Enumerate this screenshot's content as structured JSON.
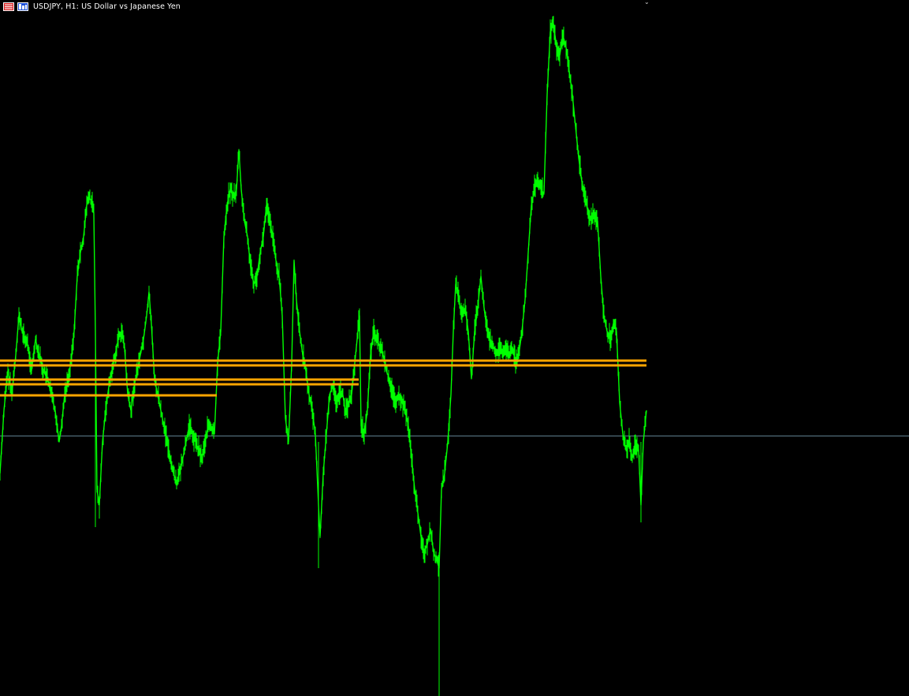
{
  "chart": {
    "title": "USDJPY, H1:  US Dollar vs Japanese Yen",
    "icons": {
      "menu": "menu-list-icon",
      "chart_type": "chart-type-icon"
    }
  },
  "colors": {
    "background": "#000000",
    "price_line": "#00ff00",
    "levels": "#ffa500",
    "current_price_line": "#5f7f8f",
    "title_text": "#ffffff"
  },
  "chart_data": {
    "type": "line",
    "title": "USDJPY, H1:  US Dollar vs Japanese Yen",
    "xlabel": "",
    "ylabel": "",
    "grid": false,
    "xlim": [
      0,
      820
    ],
    "ylim": [
      0,
      882
    ],
    "series": [
      {
        "points": [
          [
            0,
            600
          ],
          [
            5,
            520
          ],
          [
            10,
            470
          ],
          [
            15,
            500
          ],
          [
            20,
            450
          ],
          [
            24,
            400
          ],
          [
            28,
            420
          ],
          [
            32,
            430
          ],
          [
            36,
            440
          ],
          [
            40,
            470
          ],
          [
            45,
            430
          ],
          [
            50,
            450
          ],
          [
            55,
            470
          ],
          [
            60,
            480
          ],
          [
            65,
            500
          ],
          [
            70,
            520
          ],
          [
            75,
            560
          ],
          [
            78,
            540
          ],
          [
            82,
            500
          ],
          [
            86,
            480
          ],
          [
            90,
            460
          ],
          [
            94,
            420
          ],
          [
            98,
            350
          ],
          [
            102,
            320
          ],
          [
            106,
            300
          ],
          [
            110,
            260
          ],
          [
            113,
            250
          ],
          [
            116,
            255
          ],
          [
            119,
            270
          ],
          [
            121,
            420
          ],
          [
            123,
            620
          ],
          [
            126,
            640
          ],
          [
            130,
            560
          ],
          [
            134,
            520
          ],
          [
            138,
            490
          ],
          [
            142,
            470
          ],
          [
            146,
            450
          ],
          [
            150,
            430
          ],
          [
            154,
            420
          ],
          [
            158,
            440
          ],
          [
            162,
            500
          ],
          [
            166,
            520
          ],
          [
            170,
            490
          ],
          [
            174,
            470
          ],
          [
            178,
            450
          ],
          [
            182,
            430
          ],
          [
            186,
            400
          ],
          [
            189,
            370
          ],
          [
            192,
            410
          ],
          [
            196,
            480
          ],
          [
            200,
            500
          ],
          [
            204,
            520
          ],
          [
            208,
            540
          ],
          [
            212,
            560
          ],
          [
            216,
            580
          ],
          [
            220,
            600
          ],
          [
            224,
            610
          ],
          [
            228,
            600
          ],
          [
            232,
            580
          ],
          [
            236,
            560
          ],
          [
            240,
            540
          ],
          [
            244,
            550
          ],
          [
            248,
            560
          ],
          [
            252,
            570
          ],
          [
            256,
            580
          ],
          [
            260,
            560
          ],
          [
            264,
            540
          ],
          [
            268,
            545
          ],
          [
            272,
            550
          ],
          [
            276,
            460
          ],
          [
            280,
            420
          ],
          [
            284,
            300
          ],
          [
            288,
            260
          ],
          [
            292,
            240
          ],
          [
            296,
            250
          ],
          [
            300,
            240
          ],
          [
            303,
            190
          ],
          [
            306,
            240
          ],
          [
            310,
            280
          ],
          [
            314,
            300
          ],
          [
            318,
            340
          ],
          [
            322,
            360
          ],
          [
            326,
            350
          ],
          [
            330,
            320
          ],
          [
            334,
            300
          ],
          [
            338,
            260
          ],
          [
            342,
            280
          ],
          [
            346,
            300
          ],
          [
            350,
            330
          ],
          [
            354,
            350
          ],
          [
            358,
            400
          ],
          [
            362,
            530
          ],
          [
            366,
            560
          ],
          [
            370,
            460
          ],
          [
            373,
            330
          ],
          [
            376,
            380
          ],
          [
            380,
            420
          ],
          [
            384,
            450
          ],
          [
            388,
            470
          ],
          [
            392,
            500
          ],
          [
            396,
            520
          ],
          [
            400,
            550
          ],
          [
            404,
            640
          ],
          [
            406,
            680
          ],
          [
            410,
            600
          ],
          [
            414,
            550
          ],
          [
            418,
            500
          ],
          [
            422,
            490
          ],
          [
            426,
            510
          ],
          [
            430,
            500
          ],
          [
            434,
            495
          ],
          [
            438,
            520
          ],
          [
            442,
            510
          ],
          [
            446,
            500
          ],
          [
            450,
            460
          ],
          [
            454,
            420
          ],
          [
            456,
            400
          ],
          [
            458,
            540
          ],
          [
            462,
            550
          ],
          [
            466,
            520
          ],
          [
            470,
            450
          ],
          [
            474,
            420
          ],
          [
            478,
            430
          ],
          [
            482,
            440
          ],
          [
            486,
            450
          ],
          [
            490,
            470
          ],
          [
            494,
            480
          ],
          [
            498,
            500
          ],
          [
            502,
            510
          ],
          [
            506,
            505
          ],
          [
            510,
            510
          ],
          [
            514,
            520
          ],
          [
            518,
            540
          ],
          [
            522,
            580
          ],
          [
            526,
            620
          ],
          [
            530,
            650
          ],
          [
            534,
            680
          ],
          [
            538,
            700
          ],
          [
            542,
            690
          ],
          [
            546,
            670
          ],
          [
            550,
            700
          ],
          [
            554,
            710
          ],
          [
            557,
            720
          ],
          [
            560,
            620
          ],
          [
            564,
            600
          ],
          [
            568,
            560
          ],
          [
            572,
            500
          ],
          [
            575,
            420
          ],
          [
            578,
            360
          ],
          [
            582,
            380
          ],
          [
            586,
            400
          ],
          [
            590,
            390
          ],
          [
            594,
            420
          ],
          [
            598,
            480
          ],
          [
            602,
            420
          ],
          [
            606,
            390
          ],
          [
            610,
            350
          ],
          [
            614,
            390
          ],
          [
            618,
            420
          ],
          [
            622,
            430
          ],
          [
            626,
            440
          ],
          [
            630,
            450
          ],
          [
            634,
            440
          ],
          [
            638,
            450
          ],
          [
            642,
            440
          ],
          [
            646,
            450
          ],
          [
            650,
            440
          ],
          [
            654,
            460
          ],
          [
            658,
            450
          ],
          [
            662,
            420
          ],
          [
            666,
            380
          ],
          [
            670,
            320
          ],
          [
            674,
            260
          ],
          [
            678,
            240
          ],
          [
            682,
            230
          ],
          [
            686,
            240
          ],
          [
            690,
            245
          ],
          [
            694,
            120
          ],
          [
            698,
            40
          ],
          [
            702,
            30
          ],
          [
            706,
            60
          ],
          [
            710,
            70
          ],
          [
            714,
            45
          ],
          [
            718,
            60
          ],
          [
            722,
            90
          ],
          [
            726,
            120
          ],
          [
            730,
            160
          ],
          [
            734,
            200
          ],
          [
            738,
            230
          ],
          [
            742,
            250
          ],
          [
            746,
            270
          ],
          [
            750,
            280
          ],
          [
            754,
            270
          ],
          [
            758,
            280
          ],
          [
            762,
            350
          ],
          [
            766,
            400
          ],
          [
            770,
            420
          ],
          [
            774,
            430
          ],
          [
            778,
            410
          ],
          [
            782,
            420
          ],
          [
            786,
            510
          ],
          [
            790,
            550
          ],
          [
            794,
            570
          ],
          [
            798,
            560
          ],
          [
            802,
            580
          ],
          [
            806,
            560
          ],
          [
            810,
            570
          ],
          [
            813,
            640
          ],
          [
            816,
            560
          ],
          [
            820,
            520
          ]
        ]
      }
    ],
    "levels": [
      {
        "x_end": 820
      },
      {
        "x_end": 820
      },
      {
        "x_end": 455
      },
      {
        "x_end": 455
      },
      {
        "x_end": 275
      }
    ],
    "level_y": [
      457,
      463,
      481,
      487,
      501
    ],
    "current_price_y": 552
  }
}
